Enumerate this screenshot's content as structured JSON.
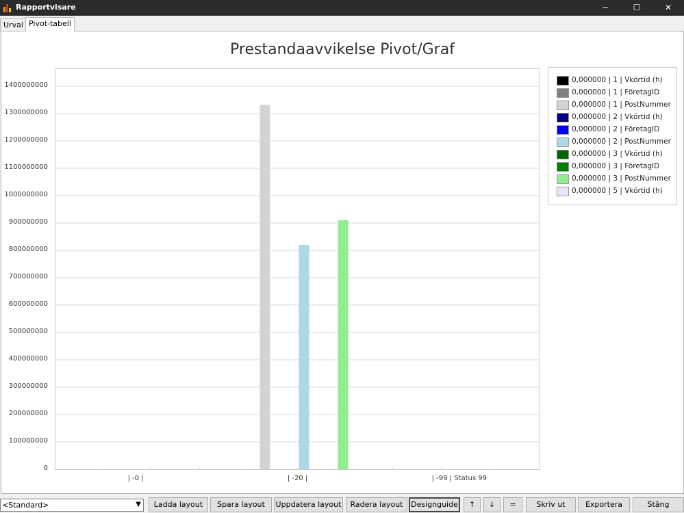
{
  "window": {
    "title": "Rapportvisare",
    "minimize": "─",
    "maximize": "☐",
    "close": "✕"
  },
  "tabs": [
    {
      "label": "Urval"
    },
    {
      "label": "Pivot-tabell"
    }
  ],
  "chart_data": {
    "type": "bar",
    "title": "Prestandaavvikelse Pivot/Graf",
    "categories": [
      "| -0 |",
      "| -20 |",
      "| -99 | Status 99"
    ],
    "ylim": [
      0,
      1450000000
    ],
    "yticks": [
      "0",
      "100000000",
      "200000000",
      "300000000",
      "400000000",
      "500000000",
      "600000000",
      "700000000",
      "800000000",
      "900000000",
      "1000000000",
      "1100000000",
      "1200000000",
      "1300000000",
      "1400000000"
    ],
    "grid": true,
    "legend_position": "right",
    "series": [
      {
        "name": "0,000000 | 1 | Vkörtid (h)",
        "color": "#000000",
        "values": [
          0,
          0,
          0
        ]
      },
      {
        "name": "0,000000 | 1 | FöretagID",
        "color": "#808080",
        "values": [
          0,
          0,
          0
        ]
      },
      {
        "name": "0,000000 | 1 | PostNummer",
        "color": "#d3d3d3",
        "values": [
          0,
          1332000000,
          0
        ]
      },
      {
        "name": "0,000000 | 2 | Vkörtid (h)",
        "color": "#00008b",
        "values": [
          0,
          0,
          0
        ]
      },
      {
        "name": "0,000000 | 2 | FöretagID",
        "color": "#0000ff",
        "values": [
          0,
          0,
          0
        ]
      },
      {
        "name": "0,000000 | 2 | PostNummer",
        "color": "#add8e6",
        "values": [
          0,
          820000000,
          0
        ]
      },
      {
        "name": "0,000000 | 3 | Vkörtid (h)",
        "color": "#006400",
        "values": [
          0,
          0,
          0
        ]
      },
      {
        "name": "0,000000 | 3 | FöretagID",
        "color": "#008000",
        "values": [
          0,
          0,
          0
        ]
      },
      {
        "name": "0,000000 | 3 | PostNummer",
        "color": "#90ee90",
        "values": [
          0,
          910000000,
          0
        ]
      },
      {
        "name": "0,000000 | 5 | Vkörtid (h)",
        "color": "#e6e6fa",
        "values": [
          0,
          0,
          0
        ]
      }
    ]
  },
  "bottom": {
    "layout_select": "<Standard>",
    "buttons": {
      "load": "Ladda layout",
      "save": "Spara layout",
      "update": "Uppdatera layout",
      "delete": "Radera layout",
      "designguide": "Designguide",
      "up": "↑",
      "down": "↓",
      "equal": "=",
      "print": "Skriv ut",
      "export": "Exportera",
      "close": "Stäng"
    }
  }
}
